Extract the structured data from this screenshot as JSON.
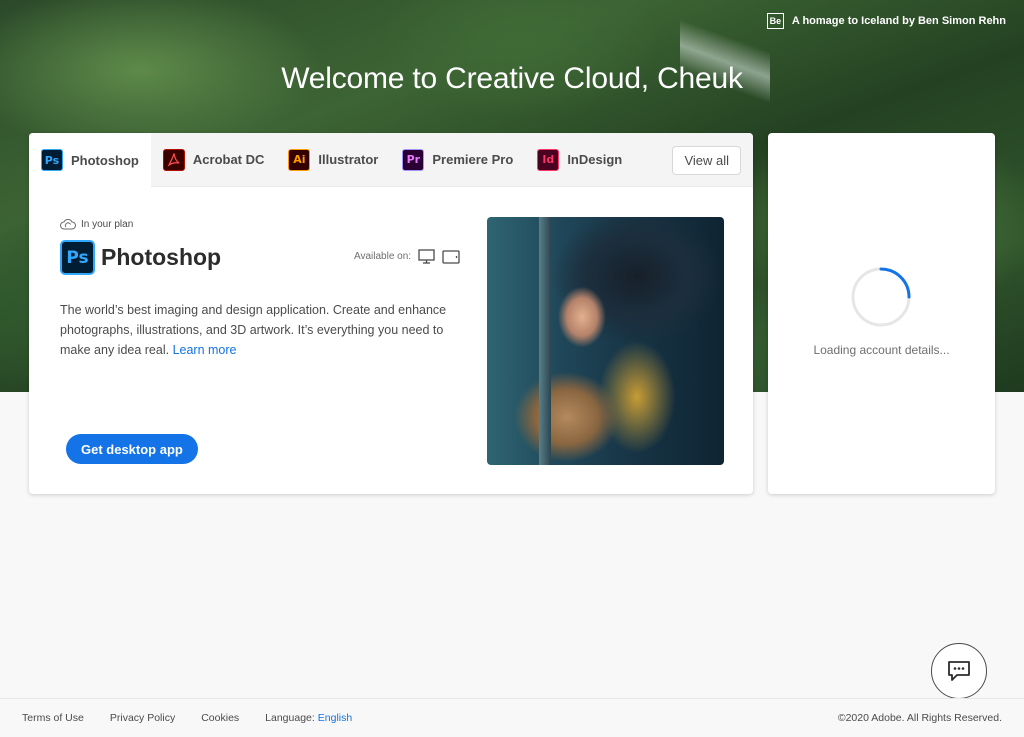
{
  "hero": {
    "welcome": "Welcome to Creative Cloud, Cheuk",
    "credit_icon": "Be",
    "credit_text": "A homage to Iceland by Ben Simon Rehn"
  },
  "tabs": [
    {
      "label": "Photoshop",
      "icon": "Ps",
      "icon_name": "photoshop-icon",
      "active": true
    },
    {
      "label": "Acrobat DC",
      "icon": "acrobat",
      "icon_name": "acrobat-icon"
    },
    {
      "label": "Illustrator",
      "icon": "Ai",
      "icon_name": "illustrator-icon"
    },
    {
      "label": "Premiere Pro",
      "icon": "Pr",
      "icon_name": "premiere-icon"
    },
    {
      "label": "InDesign",
      "icon": "Id",
      "icon_name": "indesign-icon"
    }
  ],
  "view_all": "View all",
  "product": {
    "plan_label": "In your plan",
    "icon": "Ps",
    "name": "Photoshop",
    "available_label": "Available on:",
    "platforms": [
      "desktop-icon",
      "tablet-icon"
    ],
    "description": "The world’s best imaging and design application. Create and enhance photographs, illustrations, and 3D artwork. It’s everything you need to make any idea real.",
    "learn_more": "Learn more",
    "cta": "Get desktop app"
  },
  "account": {
    "loading_text": "Loading account details..."
  },
  "footer": {
    "terms": "Terms of Use",
    "privacy": "Privacy Policy",
    "cookies": "Cookies",
    "language_label": "Language:",
    "language_value": "English",
    "copyright": "©2020 Adobe. All Rights Reserved."
  },
  "colors": {
    "accent": "#1473e6",
    "photoshop": "#31a8ff",
    "illustrator": "#ff9a00",
    "premiere": "#9999ff",
    "indesign": "#ff3366",
    "acrobat": "#b30b00"
  }
}
